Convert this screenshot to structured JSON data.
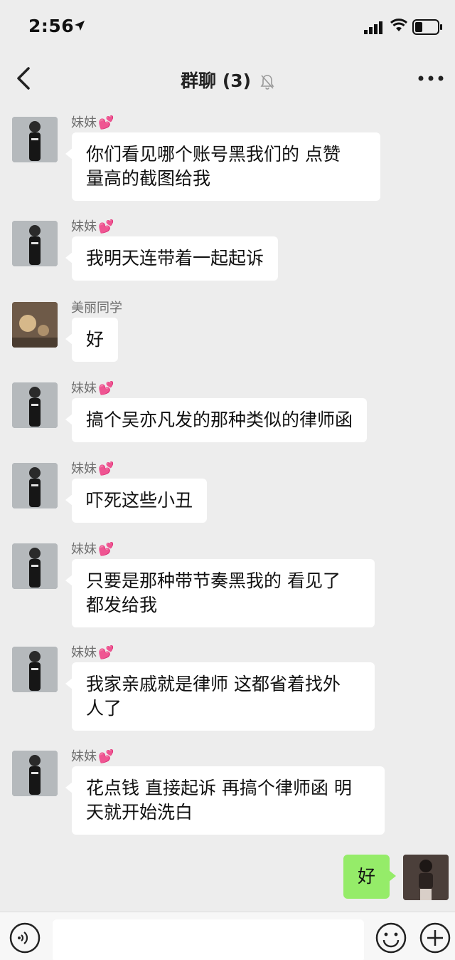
{
  "status_bar": {
    "time": "2:56",
    "icons": [
      "location-arrow-icon",
      "signal-icon",
      "wifi-icon",
      "battery-icon"
    ]
  },
  "nav": {
    "title": "群聊 (3)",
    "back_icon": "chevron-left-icon",
    "mute_icon": "bell-muted-icon",
    "more_icon": "more-dots-icon"
  },
  "messages": [
    {
      "sender": "妹妹",
      "heart": "💕",
      "lines": [
        "你们看见哪个账号黑我们的  点赞",
        "量高的截图给我"
      ]
    },
    {
      "sender": "妹妹",
      "heart": "💕",
      "lines": [
        "我明天连带着一起起诉"
      ]
    },
    {
      "sender": "美丽同学",
      "heart": "",
      "lines": [
        "好"
      ]
    },
    {
      "sender": "妹妹",
      "heart": "💕",
      "lines": [
        "搞个吴亦凡发的那种类似的律师函"
      ]
    },
    {
      "sender": "妹妹",
      "heart": "💕",
      "lines": [
        "吓死这些小丑"
      ]
    },
    {
      "sender": "妹妹",
      "heart": "💕",
      "lines": [
        "只要是那种带节奏黑我的 看见了",
        "都发给我"
      ]
    },
    {
      "sender": "妹妹",
      "heart": "💕",
      "lines": [
        "我家亲戚就是律师 这都省着找外",
        "人了"
      ]
    },
    {
      "sender": "妹妹",
      "heart": "💕",
      "lines": [
        "花点钱 直接起诉 再搞个律师函 明",
        "天就开始洗白"
      ]
    }
  ],
  "my_message": {
    "text": "好"
  },
  "input_bar": {
    "voice_icon": "voice-icon",
    "placeholder": "",
    "emoji_icon": "emoji-icon",
    "plus_icon": "plus-icon"
  },
  "colors": {
    "background": "#ededed",
    "incoming_bubble": "#ffffff",
    "outgoing_bubble": "#95ec69",
    "sender_name": "#6f6f6f"
  }
}
